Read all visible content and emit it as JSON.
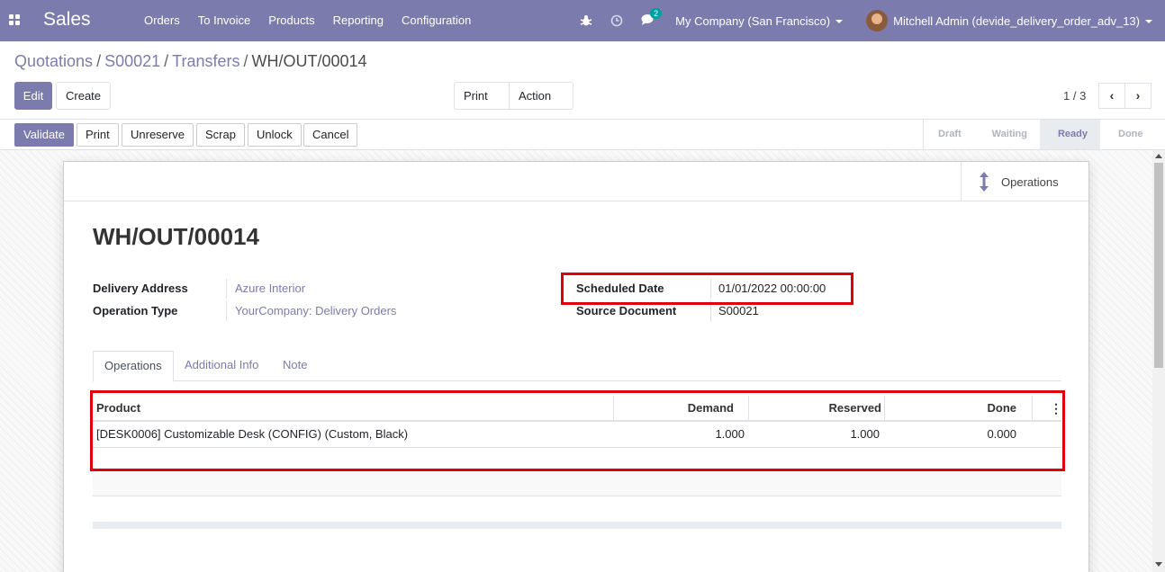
{
  "navbar": {
    "app_name": "Sales",
    "menu": [
      "Orders",
      "To Invoice",
      "Products",
      "Reporting",
      "Configuration"
    ],
    "bug_icon": "bug-icon",
    "clock_icon": "clock-icon",
    "chat_badge": "2",
    "company": "My Company (San Francisco)",
    "user": "Mitchell Admin (devide_delivery_order_adv_13)",
    "brand_color": "#7c7bad"
  },
  "breadcrumb": {
    "items": [
      "Quotations",
      "S00021",
      "Transfers"
    ],
    "current": "WH/OUT/00014"
  },
  "control": {
    "edit": "Edit",
    "create": "Create",
    "print": "Print",
    "action": "Action",
    "pager": "1 / 3"
  },
  "statusbar": {
    "buttons": [
      "Validate",
      "Print",
      "Unreserve",
      "Scrap",
      "Unlock",
      "Cancel"
    ],
    "stages": [
      "Draft",
      "Waiting",
      "Ready",
      "Done"
    ],
    "current_stage": "Ready"
  },
  "record": {
    "stat_button": "Operations",
    "title": "WH/OUT/00014",
    "fields": {
      "delivery_address_label": "Delivery Address",
      "delivery_address": "Azure Interior",
      "operation_type_label": "Operation Type",
      "operation_type": "YourCompany: Delivery Orders",
      "scheduled_date_label": "Scheduled Date",
      "scheduled_date": "01/01/2022 00:00:00",
      "source_document_label": "Source Document",
      "source_document": "S00021"
    },
    "tabs": [
      "Operations",
      "Additional Info",
      "Note"
    ],
    "table": {
      "columns": [
        "Product",
        "Demand",
        "Reserved",
        "Done"
      ],
      "rows": [
        {
          "product": "[DESK0006] Customizable Desk (CONFIG) (Custom, Black)",
          "demand": "1.000",
          "reserved": "1.000",
          "done": "0.000"
        }
      ]
    }
  },
  "highlight_color": "#e0000b"
}
